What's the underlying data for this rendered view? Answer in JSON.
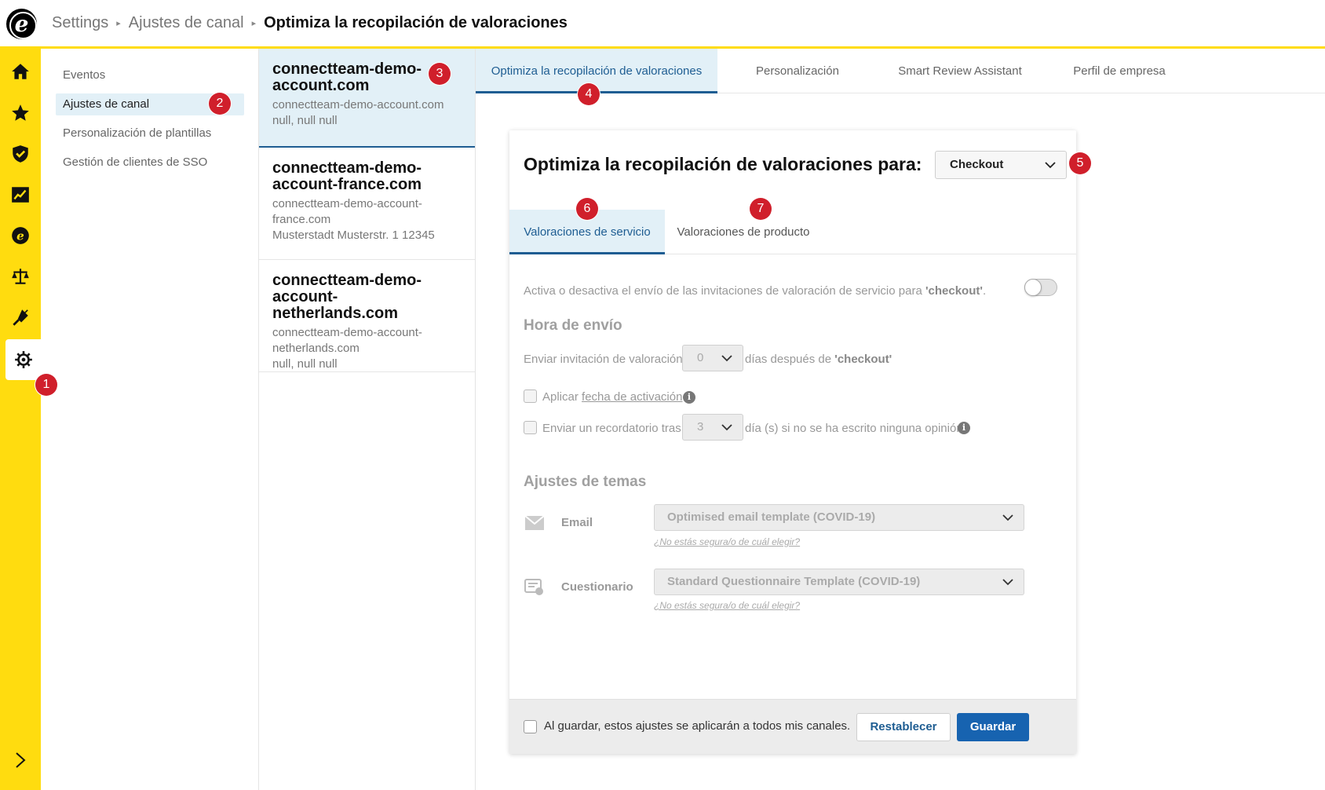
{
  "breadcrumb": {
    "items": [
      "Settings",
      "Ajustes de canal"
    ],
    "current": "Optimiza la recopilación de valoraciones",
    "separator": "▸"
  },
  "rail": {
    "items": [
      "home-icon",
      "star-icon",
      "shield-icon",
      "chart-icon",
      "etrusted-icon",
      "scale-icon",
      "plug-icon",
      "gear-icon"
    ],
    "active": "gear-icon",
    "expand": "chevron-right-icon"
  },
  "submenu": {
    "items": [
      {
        "label": "Eventos"
      },
      {
        "label": "Ajustes de canal"
      },
      {
        "label": "Personalización de plantillas"
      },
      {
        "label": "Gestión de clientes de SSO"
      }
    ]
  },
  "channels": [
    {
      "title": "connectteam-demo-account.com",
      "url": "connectteam-demo-account.com",
      "address": "null, null null"
    },
    {
      "title": "connectteam-demo-account-france.com",
      "url": "connectteam-demo-account-france.com",
      "address": "Musterstadt Musterstr. 1 12345"
    },
    {
      "title": "connectteam-demo-account-netherlands.com",
      "url": "connectteam-demo-account-netherlands.com",
      "address": "null, null null"
    }
  ],
  "tabs": [
    {
      "label": "Optimiza la recopilación de valoraciones"
    },
    {
      "label": "Personalización"
    },
    {
      "label": "Smart Review Assistant"
    },
    {
      "label": "Perfil de empresa"
    }
  ],
  "card": {
    "title": "Optimiza la recopilación de valoraciones para:",
    "event_select": "Checkout",
    "subtabs": [
      {
        "label": "Valoraciones de servicio"
      },
      {
        "label": "Valoraciones de producto"
      }
    ],
    "toggle_text_pre": "Activa o desactiva el envío de las invitaciones de valoración de servicio para ",
    "toggle_text_event": "'checkout'",
    "toggle_text_post": ".",
    "toggle_on": false,
    "send_time": {
      "heading": "Hora de envío",
      "invite_label": "Enviar invitación de valoración",
      "invite_days": "0",
      "invite_after_pre": "días después de ",
      "invite_after_event": "'checkout'",
      "apply_pre": "Aplicar ",
      "apply_link": "fecha de activación",
      "reminder_label": "Enviar un recordatorio tras",
      "reminder_days": "3",
      "reminder_after": "día (s) si no se ha escrito ninguna opinión"
    },
    "themes": {
      "heading": "Ajustes de temas",
      "email_label": "Email",
      "email_value": "Optimised email template (COVID-19)",
      "email_help": "¿No estás segura/o de cuál elegir?",
      "questionnaire_label": "Cuestionario",
      "questionnaire_value": "Standard Questionnaire Template (COVID-19)",
      "questionnaire_help": "¿No estás segura/o de cuál elegir?"
    },
    "footer": {
      "apply_all": "Al guardar, estos ajustes se aplicarán a todos mis canales.",
      "reset": "Restablecer",
      "save": "Guardar"
    }
  },
  "badges": [
    "1",
    "2",
    "3",
    "4",
    "5",
    "6",
    "7"
  ],
  "colors": {
    "accent_yellow": "#ffdc0f",
    "active_blue": "#1e5d92",
    "selected_bg": "#e2f0f7",
    "save_button": "#1763b0",
    "badge_red": "#d01f2b"
  }
}
